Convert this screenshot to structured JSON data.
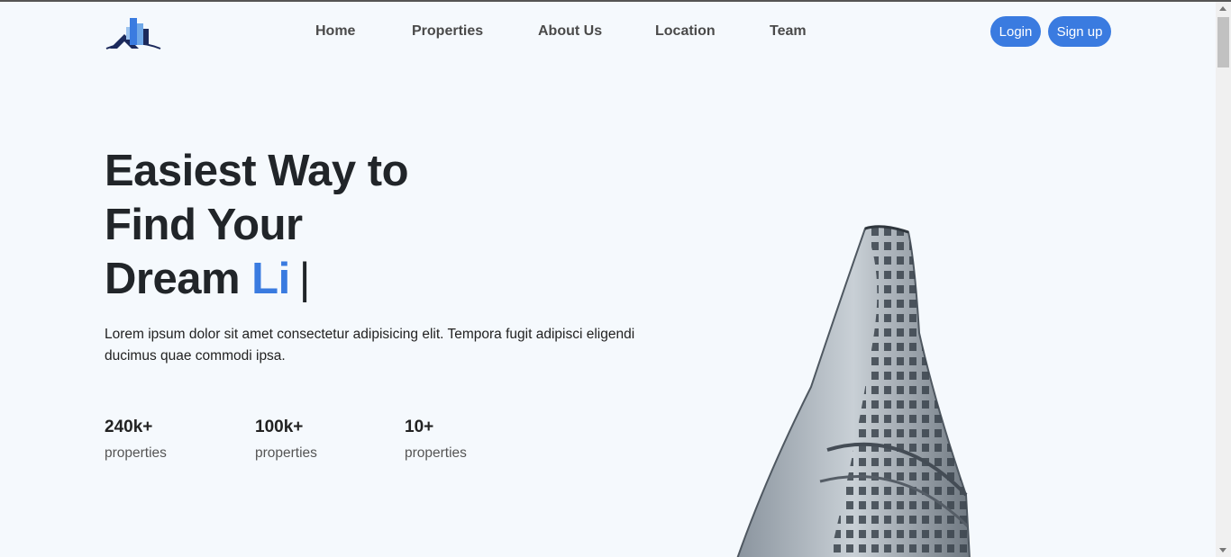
{
  "nav": {
    "items": [
      {
        "label": "Home"
      },
      {
        "label": "Properties"
      },
      {
        "label": "About Us"
      },
      {
        "label": "Location"
      },
      {
        "label": "Team"
      }
    ],
    "login_label": "Login",
    "signup_label": "Sign up"
  },
  "hero": {
    "line1": "Easiest Way to",
    "line2": "Find Your",
    "line3_prefix": "Dream ",
    "line3_accent": "Li",
    "caret": "|",
    "description": "Lorem ipsum dolor sit amet consectetur adipisicing elit. Tempora fugit adipisci eligendi ducimus quae commodi ipsa."
  },
  "stats": [
    {
      "value": "240k+",
      "label": "properties"
    },
    {
      "value": "100k+",
      "label": "properties"
    },
    {
      "value": "10+",
      "label": "properties"
    }
  ],
  "colors": {
    "accent": "#3a7be0",
    "background": "#f5f9fd",
    "heading": "#212529"
  },
  "icons": {
    "logo": "buildings-logo-icon",
    "hero_image": "flatiron-building-image"
  }
}
